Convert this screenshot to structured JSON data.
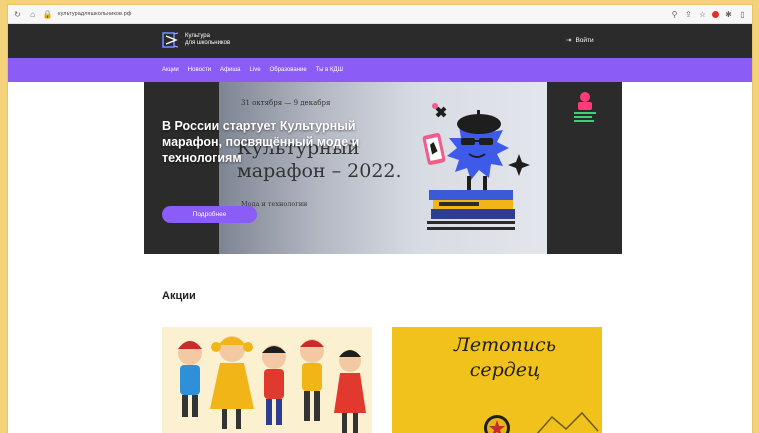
{
  "browser": {
    "url": "культурадляшкольников.рф"
  },
  "header": {
    "logo_line1": "Культура",
    "logo_line2": "для школьников",
    "login_label": "Войти"
  },
  "nav": {
    "items": [
      "Акции",
      "Новости",
      "Афиша",
      "Live",
      "Образование",
      "Ты в КДШ"
    ]
  },
  "hero": {
    "title": "В России стартует Культурный марафон, посвящённый моде и технологиям",
    "button_label": "Подробнее",
    "poster_dates": "31 октября — 9 декабря",
    "poster_big_line1": "Культурный",
    "poster_big_line2": "марафон – 2022.",
    "poster_small": "Мода и технологии"
  },
  "section": {
    "title": "Акции"
  },
  "cards": {
    "card2_text_line1": "Летопись",
    "card2_text_line2": "сердец"
  },
  "colors": {
    "accent": "#8b5cf6",
    "dark": "#2b2b2b",
    "yellow_card": "#f1c21b",
    "outer_bg": "#f3d27a"
  }
}
